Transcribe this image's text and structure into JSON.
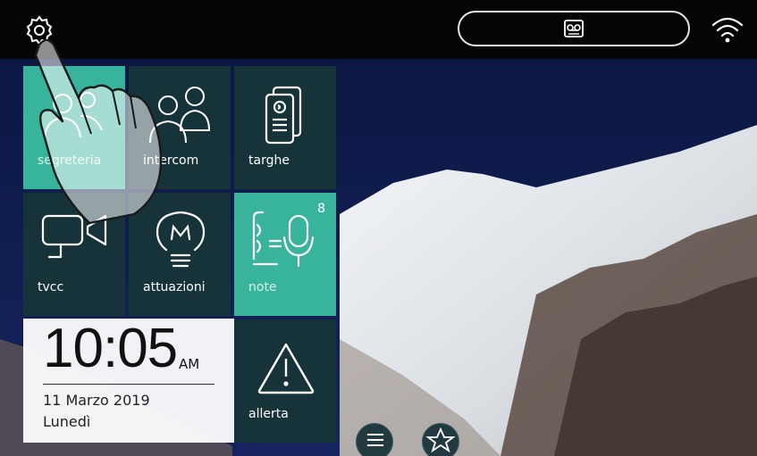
{
  "tiles": {
    "segreteria": "segreteria",
    "intercom": "intercom",
    "targhe": "targhe",
    "tvcc": "tvcc",
    "attuazioni": "attuazioni",
    "note": "note",
    "note_badge": "8",
    "allerta": "allerta"
  },
  "clock": {
    "time": "10:05",
    "ampm": "AM",
    "date": "11 Marzo 2019",
    "day": "Lunedì"
  },
  "icons": {
    "settings": "gear-icon",
    "voicemail": "voicemail-icon",
    "wifi": "wifi-icon",
    "list": "list-icon",
    "favorites": "star-icon"
  },
  "colors": {
    "tile": "#17333a",
    "tile_active": "#38b49c",
    "sky": "#0c1a4a"
  }
}
